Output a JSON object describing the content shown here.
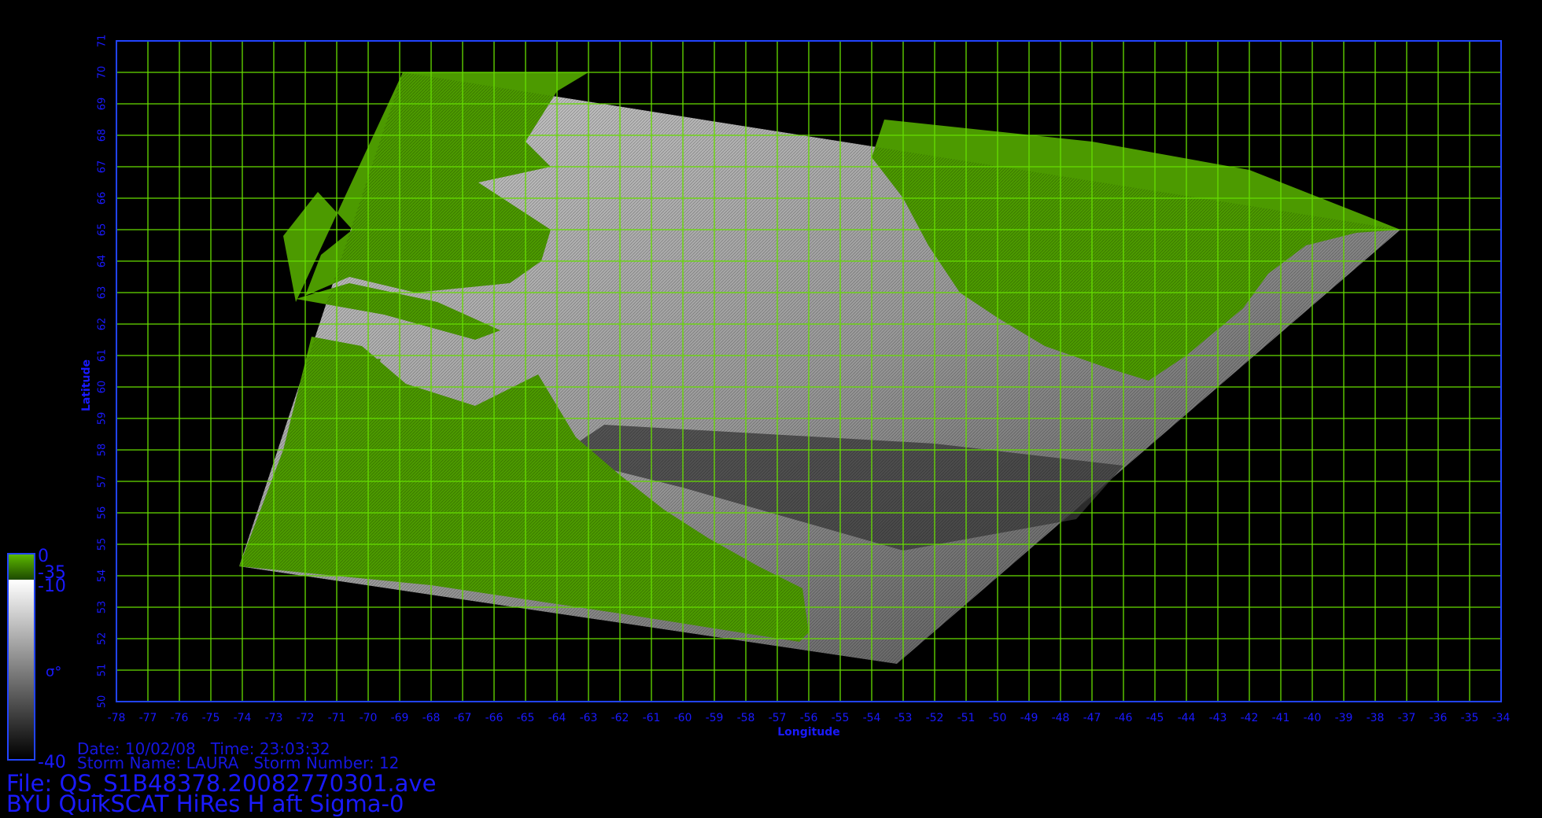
{
  "map": {
    "lon_range": [
      -78,
      -34
    ],
    "lat_range": [
      50,
      71
    ],
    "x_axis_label": "Longitude",
    "y_axis_label": "Latitude",
    "grid": true,
    "colors": {
      "grid": "#66dd00",
      "frame": "#2244ff",
      "axis_text": "#1a1aff",
      "land": "#4c9a00",
      "ocean_light": "#bdbdbd",
      "ocean_dark": "#333333"
    }
  },
  "chart_data": {
    "type": "heatmap",
    "title": "",
    "xlabel": "Longitude",
    "ylabel": "Latitude",
    "xlim": [
      -78,
      -34
    ],
    "ylim": [
      50,
      71
    ],
    "x_ticks": [
      -78,
      -77,
      -76,
      -75,
      -74,
      -73,
      -72,
      -71,
      -70,
      -69,
      -68,
      -67,
      -66,
      -65,
      -64,
      -63,
      -62,
      -61,
      -60,
      -59,
      -58,
      -57,
      -56,
      -55,
      -54,
      -53,
      -52,
      -51,
      -50,
      -49,
      -48,
      -47,
      -46,
      -45,
      -44,
      -43,
      -42,
      -41,
      -40,
      -39,
      -38,
      -37,
      -36,
      -35,
      -34
    ],
    "y_ticks": [
      50,
      51,
      52,
      53,
      54,
      55,
      56,
      57,
      58,
      59,
      60,
      61,
      62,
      63,
      64,
      65,
      66,
      67,
      68,
      69,
      70,
      71
    ],
    "swath_corners": [
      {
        "lon": -68.9,
        "lat": 70.0
      },
      {
        "lon": -37.2,
        "lat": 65.0
      },
      {
        "lon": -53.2,
        "lat": 51.2
      },
      {
        "lon": -74.1,
        "lat": 54.3
      }
    ],
    "colorbar": {
      "land_segment": {
        "top_label": "0",
        "bottom_label": "-35",
        "color": "#4c9a00"
      },
      "ocean_segment": {
        "top_label": "-10",
        "bottom_label": "-40",
        "color_top": "#ffffff",
        "color_bottom": "#000000"
      },
      "label": "σ°"
    }
  },
  "info": {
    "date_line": "Date: 10/02/08   Time: 23:03:32",
    "storm_line": "Storm Name: LAURA   Storm Number: 12",
    "file_line": "File: QS_S1B48378.20082770301.ave",
    "product_line": "BYU QuikSCAT HiRes H aft Sigma-0"
  }
}
